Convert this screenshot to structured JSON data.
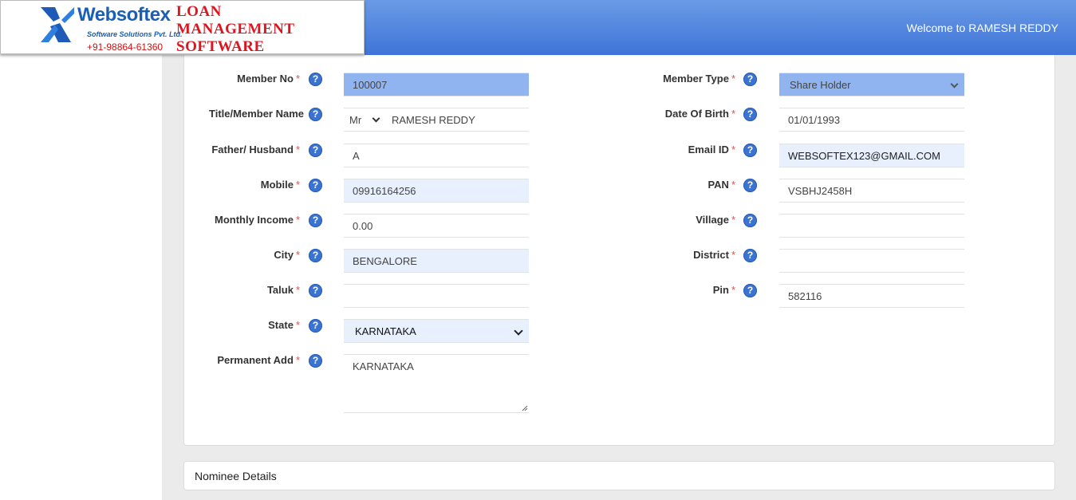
{
  "header": {
    "brand_name": "Websoftex",
    "brand_sub": "Software Solutions Pvt. Ltd.",
    "phone": "+91-98864-61360",
    "product_line1": "LOAN",
    "product_line2": "MANAGEMENT",
    "product_line3": "SOFTWARE",
    "welcome": "Welcome to RAMESH REDDY",
    "bar_color": "#3f74d8"
  },
  "form": {
    "member_no": {
      "label": "Member No",
      "value": "100007"
    },
    "member_type": {
      "label": "Member Type",
      "value": "Share Holder"
    },
    "title_name": {
      "label": "Title/Member Name",
      "title": "Mr",
      "value": "RAMESH  REDDY"
    },
    "dob": {
      "label": "Date Of Birth",
      "value": "01/01/1993"
    },
    "father": {
      "label": "Father/ Husband",
      "value": "A"
    },
    "email": {
      "label": "Email ID",
      "value": "WEBSOFTEX123@GMAIL.COM"
    },
    "mobile": {
      "label": "Mobile",
      "value": "09916164256"
    },
    "pan": {
      "label": "PAN",
      "value": "VSBHJ2458H"
    },
    "income": {
      "label": "Monthly Income",
      "value": "0.00"
    },
    "village": {
      "label": "Village",
      "value": ""
    },
    "city": {
      "label": "City",
      "value": "BENGALORE"
    },
    "district": {
      "label": "District",
      "value": ""
    },
    "taluk": {
      "label": "Taluk",
      "value": ""
    },
    "pin": {
      "label": "Pin",
      "value": "582116"
    },
    "state": {
      "label": "State",
      "value": "KARNATAKA"
    },
    "perm_add": {
      "label": "Permanent Add",
      "value": "KARNATAKA"
    },
    "required_mark": "*",
    "help_glyph": "?"
  },
  "nominee": {
    "label": "Nominee Details"
  }
}
